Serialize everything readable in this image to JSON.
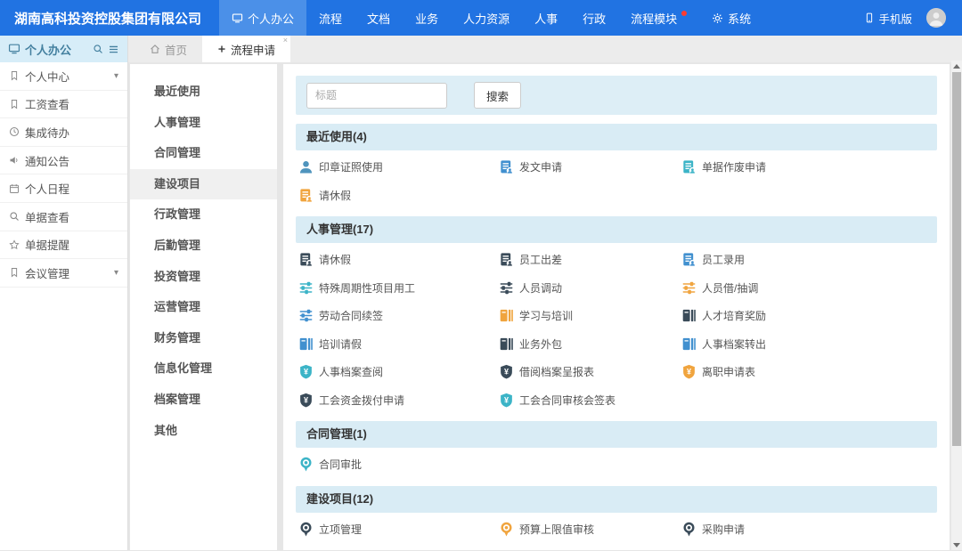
{
  "colors": {
    "navy": "#3a4b59",
    "blue": "#4190cf",
    "teal": "#3cb4c7",
    "orange": "#f0a43e",
    "steel": "#4f94bd",
    "topbar": "#2173e2",
    "topbar_active": "#4b90e8",
    "section_header_bg": "#d9ecf5",
    "sidebar_header_bg": "#d7edf8"
  },
  "topbar": {
    "company": "湖南高科投资控股集团有限公司",
    "nav": [
      {
        "label": "个人办公",
        "icon": "monitor",
        "active": true
      },
      {
        "label": "流程"
      },
      {
        "label": "文档"
      },
      {
        "label": "业务"
      },
      {
        "label": "人力资源"
      },
      {
        "label": "人事"
      },
      {
        "label": "行政"
      },
      {
        "label": "流程模块",
        "badge_dot": true
      },
      {
        "label": "系统",
        "icon": "gear"
      }
    ],
    "mobile_label": "手机版"
  },
  "sidebar": {
    "title": "个人办公",
    "items": [
      {
        "label": "个人中心",
        "icon": "bookmark",
        "expandable": true
      },
      {
        "label": "工资查看",
        "icon": "bookmark"
      },
      {
        "label": "集成待办",
        "icon": "clock"
      },
      {
        "label": "通知公告",
        "icon": "speaker"
      },
      {
        "label": "个人日程",
        "icon": "calendar"
      },
      {
        "label": "单据查看",
        "icon": "search"
      },
      {
        "label": "单据提醒",
        "icon": "star"
      },
      {
        "label": "会议管理",
        "icon": "bookmark",
        "expandable": true
      }
    ]
  },
  "tabs": [
    {
      "label": "首页",
      "icon": "home"
    },
    {
      "label": "流程申请",
      "icon": "plus",
      "active": true,
      "closable": true
    }
  ],
  "categories": [
    {
      "label": "最近使用"
    },
    {
      "label": "人事管理"
    },
    {
      "label": "合同管理"
    },
    {
      "label": "建设项目",
      "active": true
    },
    {
      "label": "行政管理"
    },
    {
      "label": "后勤管理"
    },
    {
      "label": "投资管理"
    },
    {
      "label": "运营管理"
    },
    {
      "label": "财务管理"
    },
    {
      "label": "信息化管理"
    },
    {
      "label": "档案管理"
    },
    {
      "label": "其他"
    }
  ],
  "search": {
    "placeholder": "标题",
    "button": "搜索"
  },
  "sections": [
    {
      "title": "最近使用(4)",
      "items": [
        {
          "label": "印章证照使用",
          "icon": "person",
          "color": "steel"
        },
        {
          "label": "发文申请",
          "icon": "doc",
          "color": "blue"
        },
        {
          "label": "单据作废申请",
          "icon": "doc",
          "color": "teal"
        },
        {
          "label": "请休假",
          "icon": "doc",
          "color": "orange"
        }
      ]
    },
    {
      "title": "人事管理(17)",
      "items": [
        {
          "label": "请休假",
          "icon": "doc",
          "color": "navy"
        },
        {
          "label": "员工出差",
          "icon": "doc",
          "color": "navy"
        },
        {
          "label": "员工录用",
          "icon": "doc",
          "color": "blue"
        },
        {
          "label": "特殊周期性项目用工",
          "icon": "sliders",
          "color": "teal"
        },
        {
          "label": "人员调动",
          "icon": "sliders",
          "color": "navy"
        },
        {
          "label": "人员借/抽调",
          "icon": "sliders",
          "color": "orange"
        },
        {
          "label": "劳动合同续签",
          "icon": "sliders",
          "color": "blue"
        },
        {
          "label": "学习与培训",
          "icon": "book",
          "color": "orange"
        },
        {
          "label": "人才培育奖励",
          "icon": "book",
          "color": "navy"
        },
        {
          "label": "培训请假",
          "icon": "book",
          "color": "blue"
        },
        {
          "label": "业务外包",
          "icon": "book",
          "color": "navy"
        },
        {
          "label": "人事档案转出",
          "icon": "book",
          "color": "blue"
        },
        {
          "label": "人事档案查阅",
          "icon": "shield",
          "color": "teal"
        },
        {
          "label": "借阅档案呈报表",
          "icon": "shield",
          "color": "navy"
        },
        {
          "label": "离职申请表",
          "icon": "shield",
          "color": "orange"
        },
        {
          "label": "工会资金拨付申请",
          "icon": "shield",
          "color": "navy"
        },
        {
          "label": "工会合同审核会签表",
          "icon": "shield",
          "color": "teal"
        }
      ]
    },
    {
      "title": "合同管理(1)",
      "items": [
        {
          "label": "合同审批",
          "icon": "badge",
          "color": "teal"
        }
      ]
    },
    {
      "title": "建设项目(12)",
      "items": [
        {
          "label": "立项管理",
          "icon": "badge",
          "color": "navy"
        },
        {
          "label": "预算上限值审核",
          "icon": "badge",
          "color": "orange"
        },
        {
          "label": "采购申请",
          "icon": "badge",
          "color": "navy"
        }
      ]
    }
  ]
}
